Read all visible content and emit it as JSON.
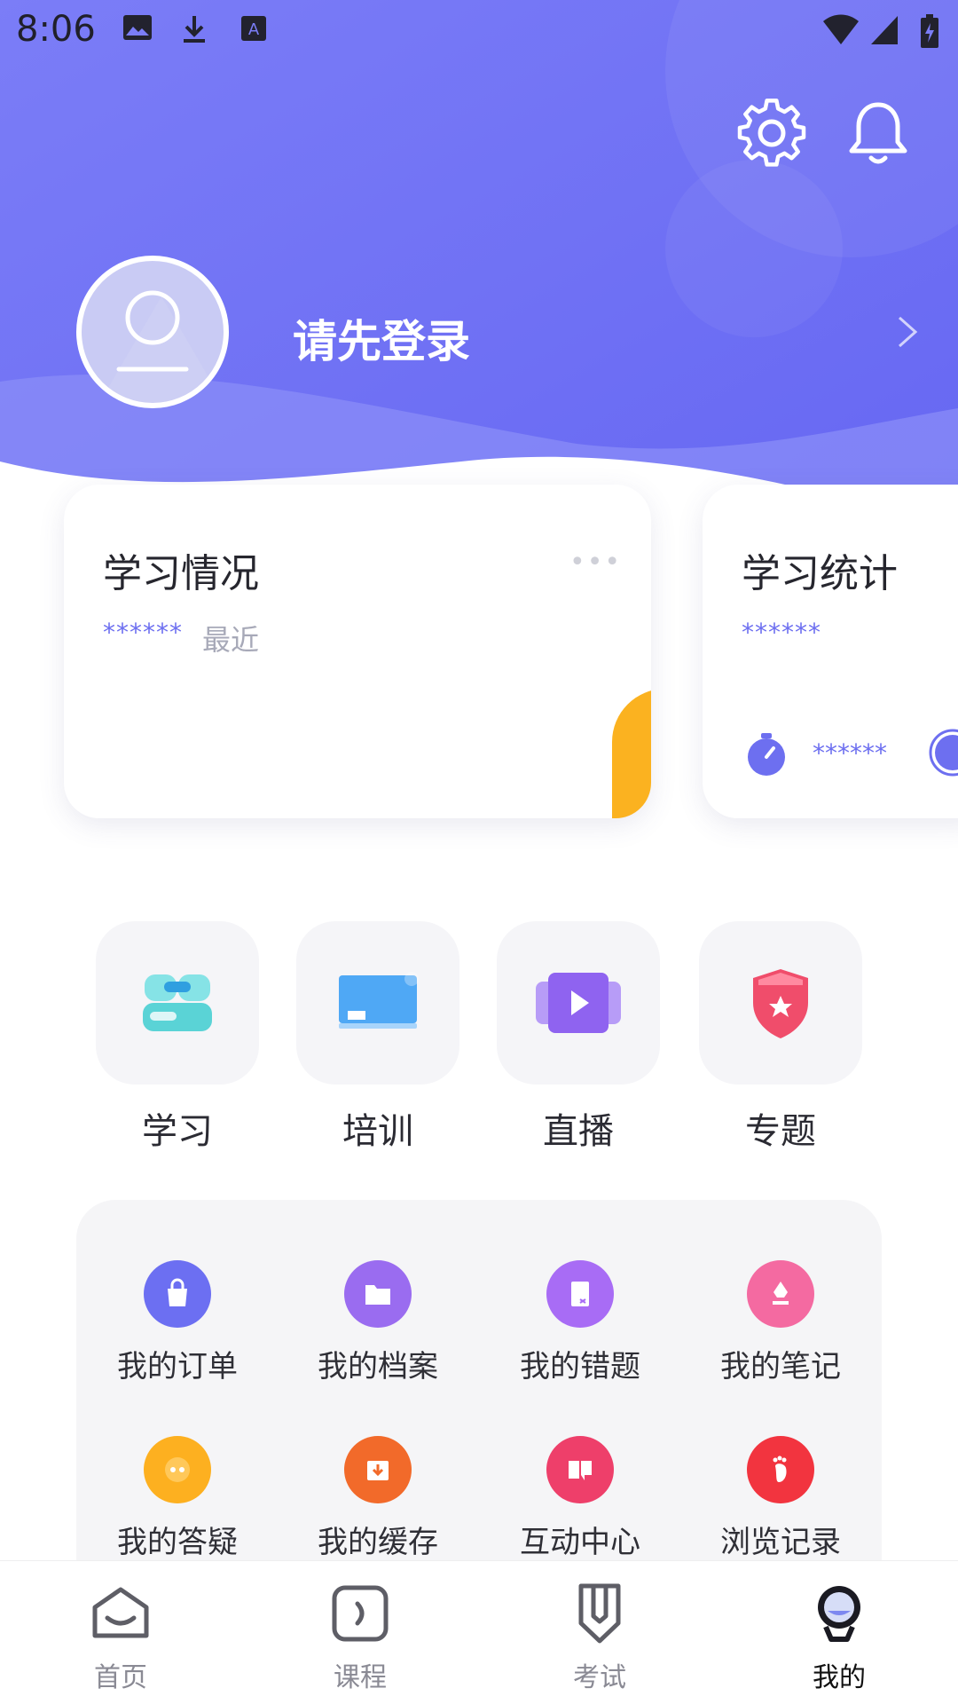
{
  "status_bar": {
    "time": "8:06"
  },
  "profile": {
    "login_prompt": "请先登录"
  },
  "cards": [
    {
      "title": "学习情况",
      "value_masked": "******",
      "period": "最近"
    },
    {
      "title": "学习统计",
      "value_masked": "******",
      "stat_value_masked": "******"
    }
  ],
  "features": [
    {
      "label": "学习",
      "icon": "study-icon"
    },
    {
      "label": "培训",
      "icon": "training-icon"
    },
    {
      "label": "直播",
      "icon": "live-icon"
    },
    {
      "label": "专题",
      "icon": "topic-icon"
    }
  ],
  "grid": [
    {
      "label": "我的订单",
      "icon": "shopping-bag-icon",
      "color": "#6c6ff2"
    },
    {
      "label": "我的档案",
      "icon": "folder-icon",
      "color": "#9a6cf0"
    },
    {
      "label": "我的错题",
      "icon": "ticket-icon",
      "color": "#a86cf5"
    },
    {
      "label": "我的笔记",
      "icon": "pen-icon",
      "color": "#f46aa1"
    },
    {
      "label": "我的答疑",
      "icon": "chat-dots-icon",
      "color": "#fdb020"
    },
    {
      "label": "我的缓存",
      "icon": "download-box-icon",
      "color": "#f26a2a"
    },
    {
      "label": "互动中心",
      "icon": "interactive-icon",
      "color": "#ee3f6a"
    },
    {
      "label": "浏览记录",
      "icon": "footprint-icon",
      "color": "#f2343f"
    }
  ],
  "nav": [
    {
      "label": "首页",
      "icon": "home-icon",
      "active": false
    },
    {
      "label": "课程",
      "icon": "course-icon",
      "active": false
    },
    {
      "label": "考试",
      "icon": "exam-icon",
      "active": false
    },
    {
      "label": "我的",
      "icon": "profile-icon",
      "active": true
    }
  ],
  "colors": {
    "primary": "#6a6cf4",
    "accent": "#fbb220"
  }
}
